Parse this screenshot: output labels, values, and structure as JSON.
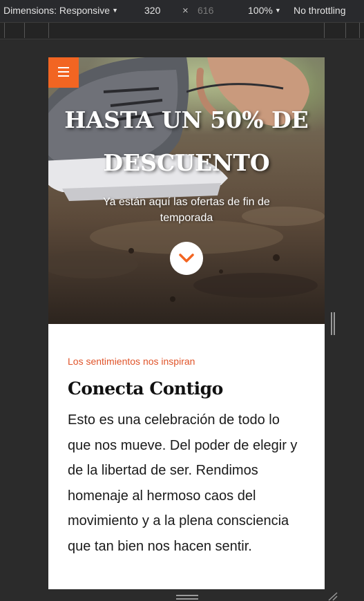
{
  "toolbar": {
    "dimensions_label": "Dimensions: Responsive",
    "width": "320",
    "times": "×",
    "height": "616",
    "zoom": "100%",
    "throttling": "No throttling"
  },
  "hero": {
    "title": "HASTA UN 50% DE DESCUENTO",
    "subtitle": "Ya están aquí las ofertas de fin de temporada",
    "menu_icon": "hamburger-menu-icon",
    "scroll_icon": "chevron-down-icon"
  },
  "content": {
    "eyebrow": "Los sentimientos nos inspiran",
    "heading": "Conecta Contigo",
    "body": "Esto es una celebración de todo lo que nos mueve. Del poder de elegir y de la libertad de ser. Rendimos homenaje al hermoso caos del movimiento y a la plena consciencia que tan bien nos hacen sentir."
  },
  "colors": {
    "accent": "#f26522",
    "eyebrow": "#e0542a",
    "devtools_bg": "#292a2d",
    "page_bg": "#2b2b2b"
  }
}
